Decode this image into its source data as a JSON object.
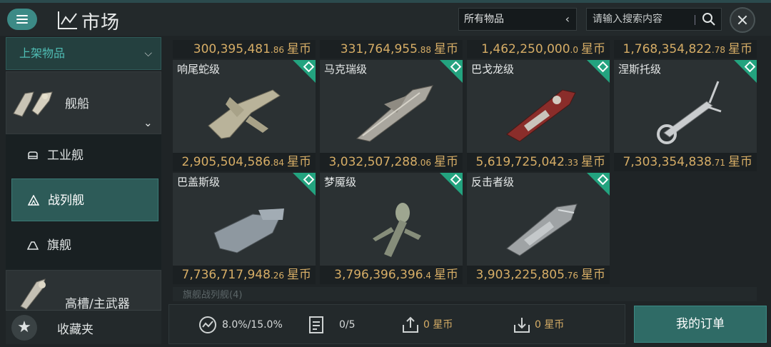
{
  "header": {
    "title": "市场",
    "filter_value": "所有物品",
    "search_placeholder": "请输入搜索内容"
  },
  "sidebar": {
    "listed_dropdown": "上架物品",
    "category_ships": "舰船",
    "sub_items": [
      {
        "label": "工业舰",
        "active": false
      },
      {
        "label": "战列舰",
        "active": true
      },
      {
        "label": "旗舰",
        "active": false
      }
    ],
    "category_weapons": "高槽/主武器",
    "favorites": "收藏夹"
  },
  "top_prices": [
    {
      "int": "300,395,481",
      "dec": ".86",
      "cur": "星币"
    },
    {
      "int": "331,764,955",
      "dec": ".88",
      "cur": "星币"
    },
    {
      "int": "1,462,250,000",
      "dec": ".0",
      "cur": "星币"
    },
    {
      "int": "1,768,354,822",
      "dec": ".78",
      "cur": "星币"
    }
  ],
  "items": [
    {
      "name": "响尾蛇级",
      "price_int": "2,905,504,586",
      "price_dec": ".84",
      "cur": "星币",
      "ship_color": "#b9b39a"
    },
    {
      "name": "马克瑞级",
      "price_int": "3,032,507,288",
      "price_dec": ".06",
      "cur": "星币",
      "ship_color": "#a9a69e"
    },
    {
      "name": "巴戈龙级",
      "price_int": "5,619,725,042",
      "price_dec": ".33",
      "cur": "星币",
      "ship_color": "#8a2d2a"
    },
    {
      "name": "涅斯托级",
      "price_int": "7,303,354,838",
      "price_dec": ".71",
      "cur": "星币",
      "ship_color": "#c9ccce"
    },
    {
      "name": "巴盖斯级",
      "price_int": "7,736,717,948",
      "price_dec": ".26",
      "cur": "星币",
      "ship_color": "#8e98a0"
    },
    {
      "name": "梦魇级",
      "price_int": "3,796,396,396",
      "price_dec": ".4",
      "cur": "星币",
      "ship_color": "#9ea690"
    },
    {
      "name": "反击者级",
      "price_int": "3,903,225,805",
      "price_dec": ".76",
      "cur": "星币",
      "ship_color": "#9fa3a5"
    }
  ],
  "more_label": "旗舰战列舰(4)",
  "bottom": {
    "tax": "8.0%/15.0%",
    "orders_count": "0/5",
    "sell_amount": "0 星币",
    "buy_amount": "0 星币",
    "my_orders": "我的订单"
  },
  "colors": {
    "accent": "#3c8a86",
    "price": "#d6ad66",
    "badge": "#23a37f"
  }
}
